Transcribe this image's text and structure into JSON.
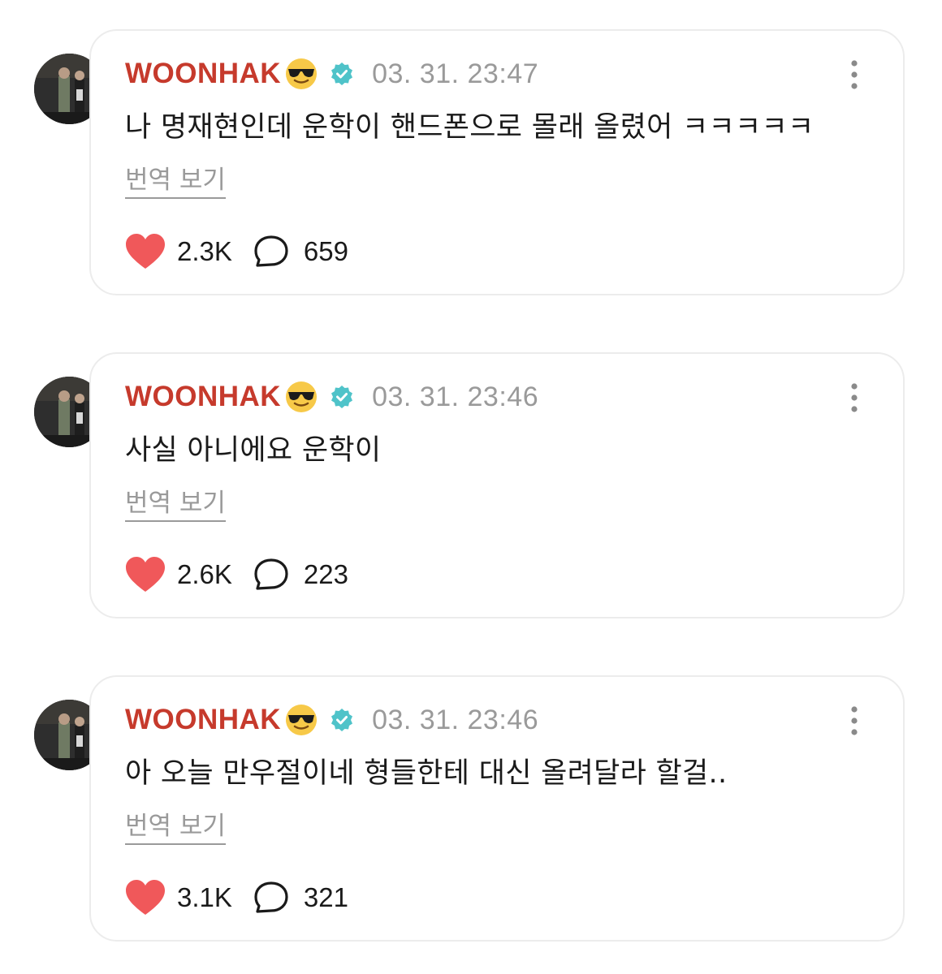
{
  "posts": [
    {
      "username": "WOONHAK",
      "timestamp": "03. 31. 23:47",
      "body": "나 명재현인데 운학이 핸드폰으로 몰래 올렸어 ㅋㅋㅋㅋㅋ",
      "translate_label": "번역 보기",
      "likes": "2.3K",
      "comments": "659"
    },
    {
      "username": "WOONHAK",
      "timestamp": "03. 31. 23:46",
      "body": "사실 아니에요 운학이",
      "translate_label": "번역 보기",
      "likes": "2.6K",
      "comments": "223"
    },
    {
      "username": "WOONHAK",
      "timestamp": "03. 31. 23:46",
      "body": "아 오늘 만우절이네 형들한테 대신 올려달라 할걸..",
      "translate_label": "번역 보기",
      "likes": "3.1K",
      "comments": "321"
    }
  ],
  "icons": {
    "username_emoji": "sunglasses-emoji",
    "verified": "verified-badge-icon",
    "more": "more-vertical-icon",
    "like": "heart-icon",
    "comment": "comment-bubble-icon"
  },
  "colors": {
    "username": "#c63a2c",
    "timestamp": "#9a9a9a",
    "heart": "#f0585a",
    "verified": "#4fc3c9",
    "card_border": "#ececec"
  }
}
